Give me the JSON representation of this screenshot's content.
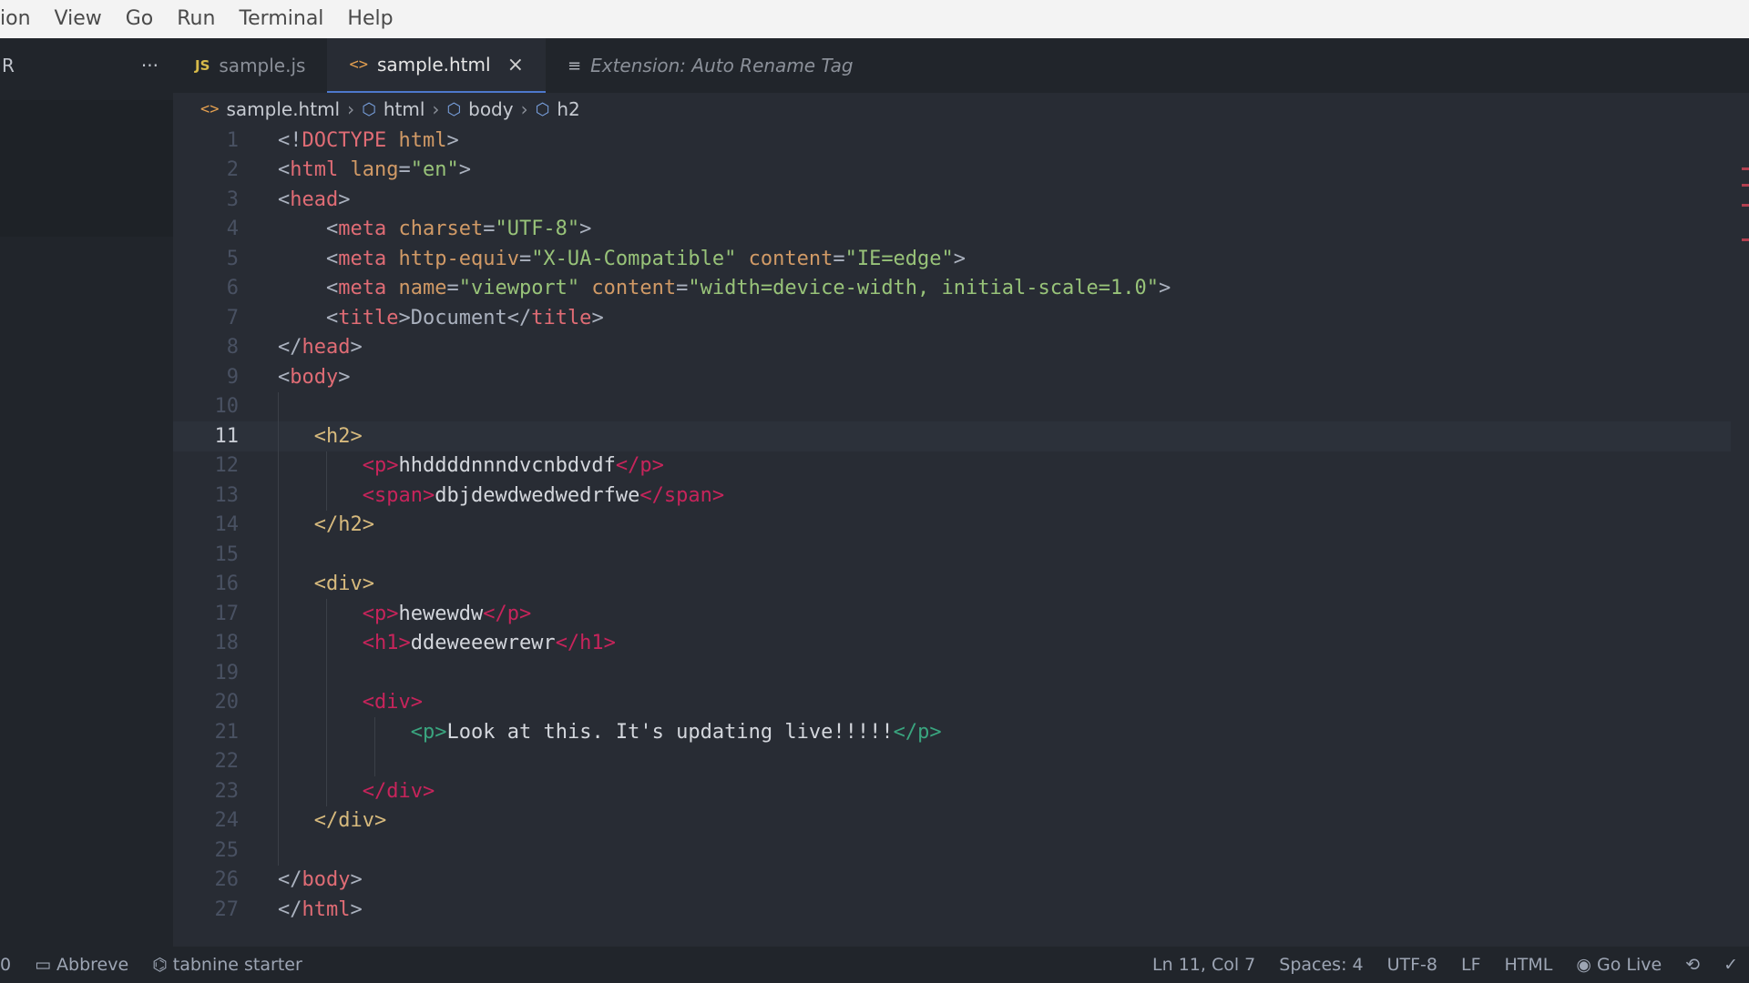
{
  "menu": [
    "ion",
    "View",
    "Go",
    "Run",
    "Terminal",
    "Help"
  ],
  "sidebar": {
    "title_fragment": "R",
    "more": "···"
  },
  "tabs": [
    {
      "label": "sample.js",
      "icon": "JS"
    },
    {
      "label": "sample.html",
      "icon": "<>",
      "close": "×"
    },
    {
      "label": "Extension: Auto Rename Tag",
      "icon": "≡"
    }
  ],
  "breadcrumb": [
    "sample.html",
    "html",
    "body",
    "h2"
  ],
  "editor": {
    "current_line": 11,
    "lines": [
      {
        "n": "1",
        "tokens": [
          [
            "t-punc",
            "<!"
          ],
          [
            "t-tag",
            "DOCTYPE"
          ],
          [
            "t-punc",
            " "
          ],
          [
            "t-attr",
            "html"
          ],
          [
            "t-punc",
            ">"
          ]
        ],
        "indent": 0
      },
      {
        "n": "2",
        "tokens": [
          [
            "t-punc",
            "<"
          ],
          [
            "t-tag",
            "html"
          ],
          [
            "t-punc",
            " "
          ],
          [
            "t-attr",
            "lang"
          ],
          [
            "t-punc",
            "="
          ],
          [
            "t-str",
            "\"en\""
          ],
          [
            "t-punc",
            ">"
          ]
        ],
        "indent": 0
      },
      {
        "n": "3",
        "tokens": [
          [
            "t-punc",
            "<"
          ],
          [
            "t-tag",
            "head"
          ],
          [
            "t-punc",
            ">"
          ]
        ],
        "indent": 0
      },
      {
        "n": "4",
        "tokens": [
          [
            "t-punc",
            "<"
          ],
          [
            "t-tag",
            "meta"
          ],
          [
            "t-punc",
            " "
          ],
          [
            "t-attr",
            "charset"
          ],
          [
            "t-punc",
            "="
          ],
          [
            "t-str",
            "\"UTF-8\""
          ],
          [
            "t-punc",
            ">"
          ]
        ],
        "indent": 4
      },
      {
        "n": "5",
        "tokens": [
          [
            "t-punc",
            "<"
          ],
          [
            "t-tag",
            "meta"
          ],
          [
            "t-punc",
            " "
          ],
          [
            "t-attr",
            "http-equiv"
          ],
          [
            "t-punc",
            "="
          ],
          [
            "t-str",
            "\"X-UA-Compatible\""
          ],
          [
            "t-punc",
            " "
          ],
          [
            "t-attr",
            "content"
          ],
          [
            "t-punc",
            "="
          ],
          [
            "t-str",
            "\"IE=edge\""
          ],
          [
            "t-punc",
            ">"
          ]
        ],
        "indent": 4
      },
      {
        "n": "6",
        "tokens": [
          [
            "t-punc",
            "<"
          ],
          [
            "t-tag",
            "meta"
          ],
          [
            "t-punc",
            " "
          ],
          [
            "t-attr",
            "name"
          ],
          [
            "t-punc",
            "="
          ],
          [
            "t-str",
            "\"viewport\""
          ],
          [
            "t-punc",
            " "
          ],
          [
            "t-attr",
            "content"
          ],
          [
            "t-punc",
            "="
          ],
          [
            "t-str",
            "\"width=device-width, initial-scale=1.0\""
          ],
          [
            "t-punc",
            ">"
          ]
        ],
        "indent": 4
      },
      {
        "n": "7",
        "tokens": [
          [
            "t-punc",
            "<"
          ],
          [
            "t-tag",
            "title"
          ],
          [
            "t-punc",
            ">"
          ],
          [
            "t-text",
            "Document"
          ],
          [
            "t-punc",
            "</"
          ],
          [
            "t-tag",
            "title"
          ],
          [
            "t-punc",
            ">"
          ]
        ],
        "indent": 4
      },
      {
        "n": "8",
        "tokens": [
          [
            "t-punc",
            "</"
          ],
          [
            "t-tag",
            "head"
          ],
          [
            "t-punc",
            ">"
          ]
        ],
        "indent": 0
      },
      {
        "n": "9",
        "tokens": [
          [
            "t-punc",
            "<"
          ],
          [
            "t-tag",
            "body"
          ],
          [
            "t-punc",
            ">"
          ]
        ],
        "indent": 0
      },
      {
        "n": "10",
        "tokens": [],
        "indent": 0
      },
      {
        "n": "11",
        "tokens": [
          [
            "t-gold",
            "<h2>"
          ]
        ],
        "indent": 3
      },
      {
        "n": "12",
        "tokens": [
          [
            "t-pink",
            "<p>"
          ],
          [
            "t-white",
            "hhddddnnndvcnbdvdf"
          ],
          [
            "t-pink",
            "</p>"
          ]
        ],
        "indent": 7
      },
      {
        "n": "13",
        "tokens": [
          [
            "t-pink",
            "<span>"
          ],
          [
            "t-white",
            "dbjdewdwedwedrfwe"
          ],
          [
            "t-pink",
            "</span>"
          ]
        ],
        "indent": 7
      },
      {
        "n": "14",
        "tokens": [
          [
            "t-gold",
            "</h2>"
          ]
        ],
        "indent": 3
      },
      {
        "n": "15",
        "tokens": [],
        "indent": 0
      },
      {
        "n": "16",
        "tokens": [
          [
            "t-gold",
            "<div>"
          ]
        ],
        "indent": 3
      },
      {
        "n": "17",
        "tokens": [
          [
            "t-pink",
            "<p>"
          ],
          [
            "t-white",
            "hewewdw"
          ],
          [
            "t-pink",
            "</p>"
          ]
        ],
        "indent": 7
      },
      {
        "n": "18",
        "tokens": [
          [
            "t-pink",
            "<h1>"
          ],
          [
            "t-white",
            "ddeweeewrewr"
          ],
          [
            "t-pink",
            "</h1>"
          ]
        ],
        "indent": 7
      },
      {
        "n": "19",
        "tokens": [],
        "indent": 0
      },
      {
        "n": "20",
        "tokens": [
          [
            "t-pink",
            "<div>"
          ]
        ],
        "indent": 7
      },
      {
        "n": "21",
        "tokens": [
          [
            "t-green",
            "<p>"
          ],
          [
            "t-white",
            "Look at this. It's updating live!!!!!"
          ],
          [
            "t-green",
            "</p>"
          ]
        ],
        "indent": 11
      },
      {
        "n": "22",
        "tokens": [],
        "indent": 0
      },
      {
        "n": "23",
        "tokens": [
          [
            "t-pink",
            "</div>"
          ]
        ],
        "indent": 7
      },
      {
        "n": "24",
        "tokens": [
          [
            "t-gold",
            "</div>"
          ]
        ],
        "indent": 3
      },
      {
        "n": "25",
        "tokens": [],
        "indent": 0
      },
      {
        "n": "26",
        "tokens": [
          [
            "t-punc",
            "</"
          ],
          [
            "t-tag",
            "body"
          ],
          [
            "t-punc",
            ">"
          ]
        ],
        "indent": 0
      },
      {
        "n": "27",
        "tokens": [
          [
            "t-punc",
            "</"
          ],
          [
            "t-tag",
            "html"
          ],
          [
            "t-punc",
            ">"
          ]
        ],
        "indent": 0
      }
    ]
  },
  "statusbar": {
    "left": [
      {
        "label": "0"
      },
      {
        "label": "Abbreve",
        "icon": "folder-icon"
      },
      {
        "label": "tabnine starter",
        "icon": "tabnine-icon"
      }
    ],
    "position": "Ln 11, Col 7",
    "spaces": "Spaces: 4",
    "encoding": "UTF-8",
    "eol": "LF",
    "language": "HTML",
    "golive": "Go Live"
  }
}
